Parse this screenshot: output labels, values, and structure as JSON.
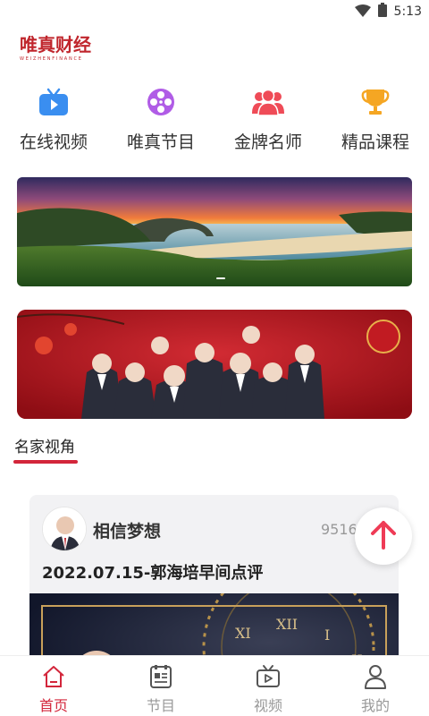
{
  "status_bar": {
    "time": "5:13",
    "icons": [
      "wifi-icon",
      "battery-icon"
    ]
  },
  "brand": {
    "name": "唯真财经",
    "subtitle": "WEIZHENFINANCE",
    "color": "#c0262d"
  },
  "quick_nav": [
    {
      "label": "在线视频",
      "icon": "tv-icon",
      "color": "#3a8ef0"
    },
    {
      "label": "唯真节目",
      "icon": "film-reel-icon",
      "color": "#b05ce6"
    },
    {
      "label": "金牌名师",
      "icon": "people-icon",
      "color": "#ef4b57"
    },
    {
      "label": "精品课程",
      "icon": "trophy-icon",
      "color": "#f5a623"
    }
  ],
  "banner": {
    "image": "coastal-sunset-landscape"
  },
  "promo": {
    "image": "teachers-group-photo"
  },
  "section": {
    "title": "名家视角"
  },
  "feed": [
    {
      "author": "相信梦想",
      "count": "9516",
      "headline": "2022.07.15-郭海培早间点评"
    }
  ],
  "tabs": [
    {
      "label": "首页",
      "icon": "home-icon",
      "active": true
    },
    {
      "label": "节目",
      "icon": "program-icon",
      "active": false
    },
    {
      "label": "视频",
      "icon": "video-icon",
      "active": false
    },
    {
      "label": "我的",
      "icon": "user-icon",
      "active": false
    }
  ],
  "colors": {
    "accent": "#d3263b",
    "inactive": "#999999"
  }
}
